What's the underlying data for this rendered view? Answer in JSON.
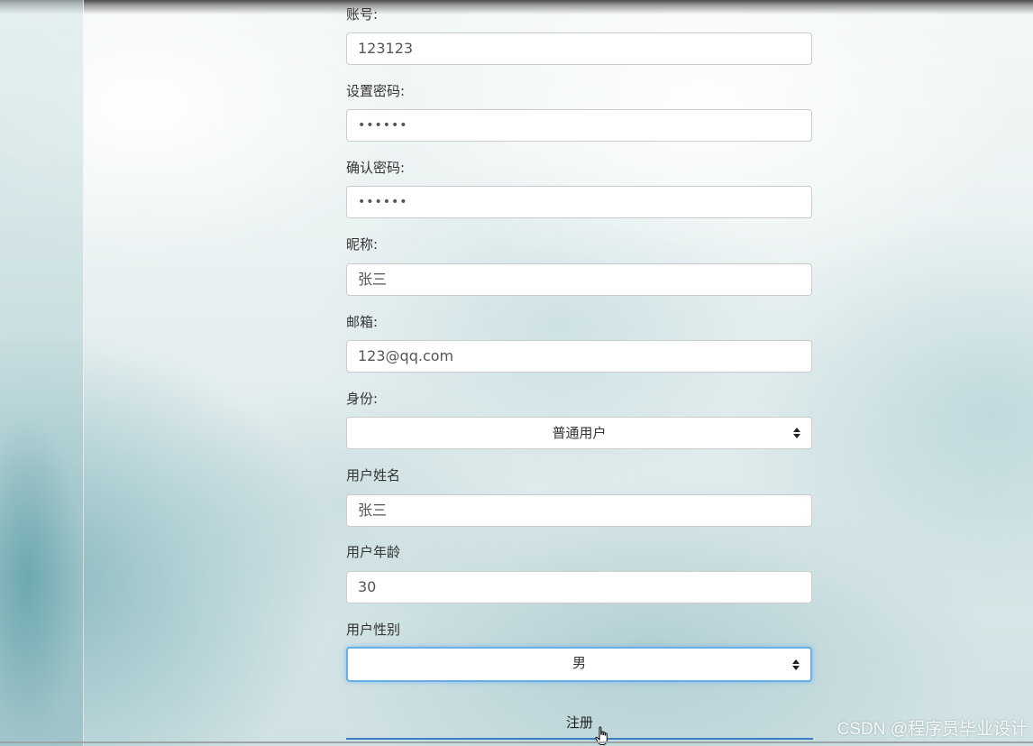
{
  "form": {
    "account": {
      "label": "账号:",
      "value": "123123"
    },
    "password": {
      "label": "设置密码:",
      "value": "••••••"
    },
    "confirm_password": {
      "label": "确认密码:",
      "value": "••••••"
    },
    "nickname": {
      "label": "昵称:",
      "value": "张三"
    },
    "email": {
      "label": "邮箱:",
      "value": "123@qq.com"
    },
    "identity": {
      "label": "身份:",
      "selected": "普通用户"
    },
    "real_name": {
      "label": "用户姓名",
      "value": "张三"
    },
    "age": {
      "label": "用户年龄",
      "value": "30"
    },
    "gender": {
      "label": "用户性别",
      "selected": "男"
    },
    "submit_label": "注册"
  },
  "watermark": "CSDN @程序员毕业设计",
  "colors": {
    "focus_border": "#66afe9",
    "submit_underline": "#3a7fc0"
  },
  "icons": {
    "select_caret": "up-down-caret-icon",
    "cursor": "hand-pointer-icon"
  }
}
